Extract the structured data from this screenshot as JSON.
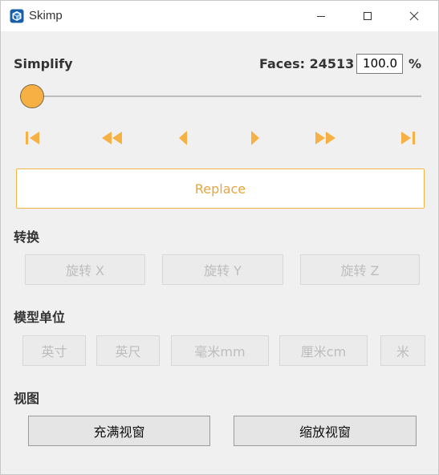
{
  "window": {
    "title": "Skimp",
    "app_icon": "skimp-cube-icon",
    "controls": [
      "minimize-icon",
      "maximize-icon",
      "close-icon"
    ]
  },
  "simplify": {
    "label": "Simplify",
    "faces_text": "Faces: 24513",
    "percent_value": "100.0",
    "percent_sign": "%",
    "slider_value_fraction": 0.0
  },
  "playback": {
    "buttons": [
      "skip-to-start-icon",
      "fast-rewind-icon",
      "step-back-icon",
      "step-forward-icon",
      "fast-forward-icon",
      "skip-to-end-icon"
    ],
    "accent_color": "#f7b043"
  },
  "replace_label": "Replace",
  "rotate": {
    "heading": "转换",
    "buttons": [
      "旋转 X",
      "旋转 Y",
      "旋转 Z"
    ]
  },
  "units": {
    "heading": "模型单位",
    "buttons": [
      "英寸",
      "英尺",
      "毫米mm",
      "厘米cm",
      "米"
    ]
  },
  "view": {
    "heading": "视图",
    "buttons": [
      "充满视窗",
      "缩放视窗"
    ]
  }
}
